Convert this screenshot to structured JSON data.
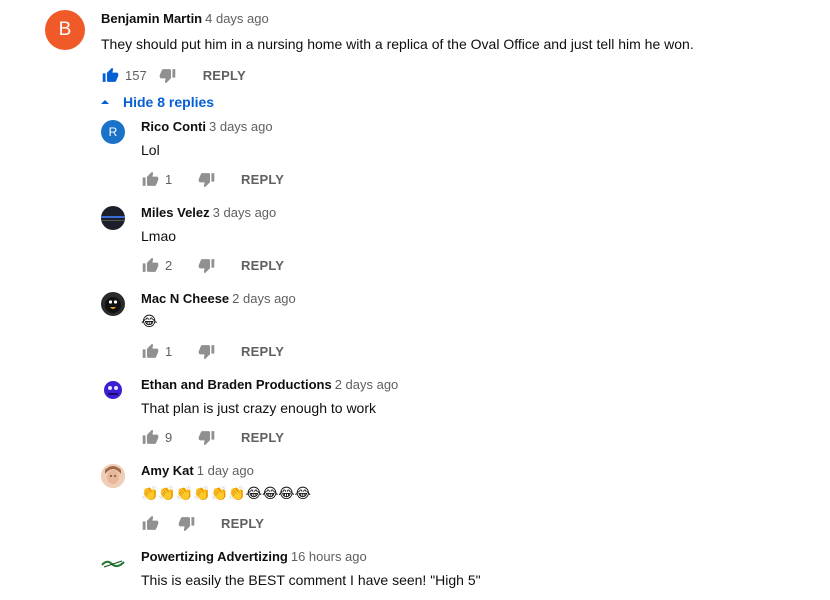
{
  "top_comment": {
    "avatar_letter": "B",
    "author": "Benjamin Martin",
    "time": "4 days ago",
    "text": "They should put him in a nursing home with a replica of the Oval Office and just tell him he won.",
    "likes": "157",
    "reply_label": "REPLY"
  },
  "toggle": {
    "label": "Hide 8 replies"
  },
  "replies": [
    {
      "avatar_letter": "R",
      "author": "Rico Conti",
      "time": "3 days ago",
      "text": "Lol",
      "likes": "1",
      "reply_label": "REPLY"
    },
    {
      "author": "Miles Velez",
      "time": "3 days ago",
      "text": "Lmao",
      "likes": "2",
      "reply_label": "REPLY"
    },
    {
      "author": "Mac N Cheese",
      "time": "2 days ago",
      "text": "😂",
      "likes": "1",
      "reply_label": "REPLY"
    },
    {
      "author": "Ethan and Braden Productions",
      "time": "2 days ago",
      "text": "That plan is just crazy enough to work",
      "likes": "9",
      "reply_label": "REPLY"
    },
    {
      "author": "Amy Kat",
      "time": "1 day ago",
      "text": "👏👏👏👏👏👏😂😂😂😂",
      "likes": "",
      "reply_label": "REPLY"
    },
    {
      "author": "Powertizing Advertizing",
      "time": "16 hours ago",
      "text": "This is easily the BEST comment I have seen! \"High 5\""
    }
  ],
  "colors": {
    "link_blue": "#065fd4",
    "avatar_orange": "#ef5a28",
    "avatar_blue": "#1a73c8",
    "muted_gray": "#606060"
  },
  "icons": {
    "like": "thumbs-up-icon",
    "dislike": "thumbs-down-icon",
    "toggle": "caret-up-icon"
  }
}
